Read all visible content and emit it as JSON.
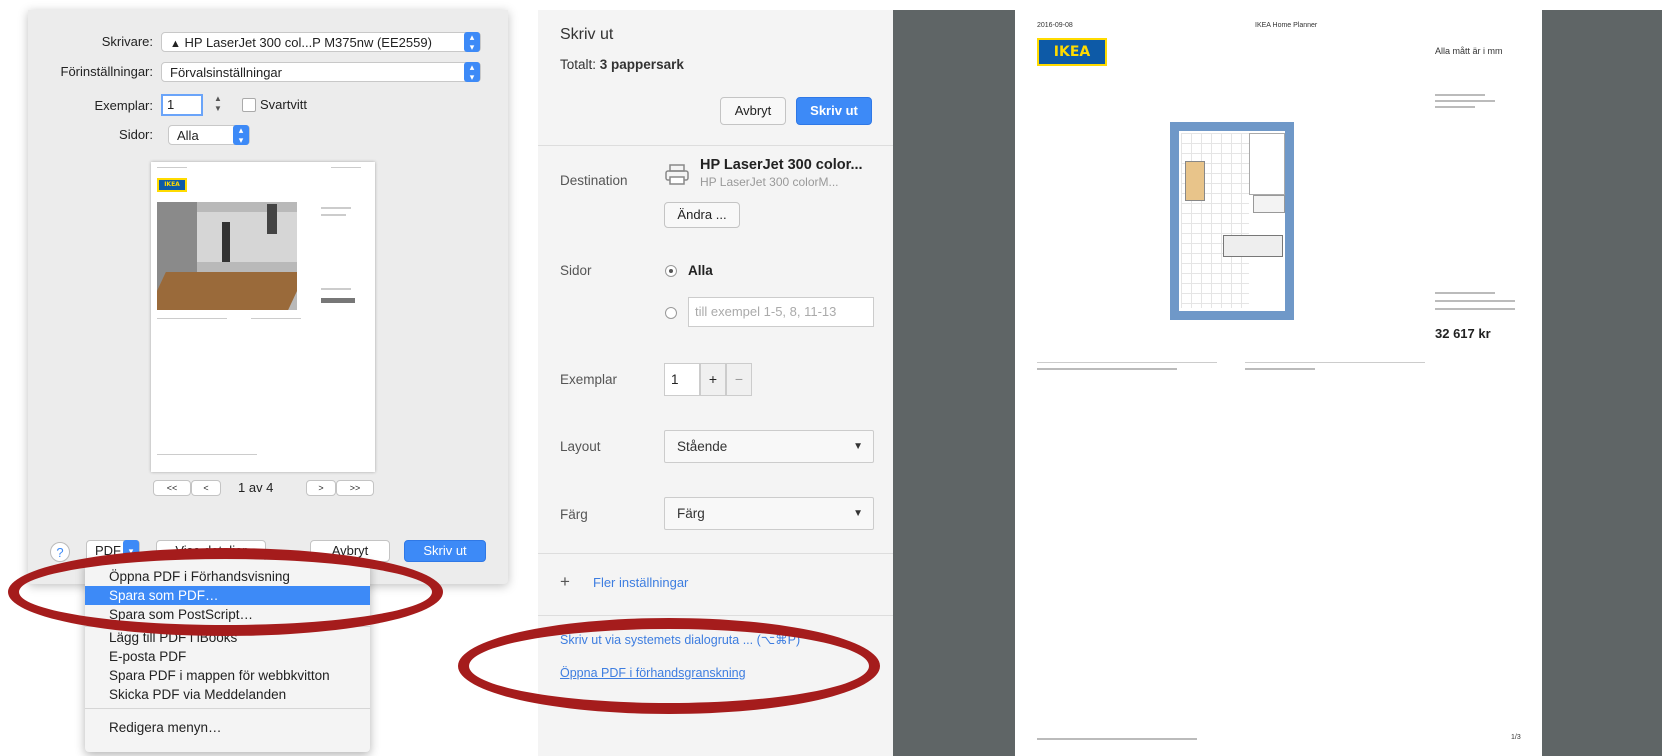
{
  "mac_dialog": {
    "printer_label": "Skrivare:",
    "printer_value": "HP LaserJet 300 col...P M375nw (EE2559)",
    "presets_label": "Förinställningar:",
    "presets_value": "Förvalsinställningar",
    "copies_label": "Exemplar:",
    "copies_value": "1",
    "bw_label": "Svartvitt",
    "pages_label": "Sidor:",
    "pages_value": "Alla",
    "pager_text": "1 av 4",
    "nav_first": "<<",
    "nav_prev": "<",
    "nav_next": ">",
    "nav_last": ">>",
    "help": "?",
    "pdf_button": "PDF",
    "details_button": "Visa detaljer",
    "cancel_button": "Avbryt",
    "print_button": "Skriv ut"
  },
  "pdf_menu": {
    "items": [
      "Öppna PDF i Förhandsvisning",
      "Spara som PDF…",
      "Spara som PostScript…",
      "Lägg till PDF i iBooks",
      "E-posta PDF",
      "Spara PDF i mappen för webbkvitton",
      "Skicka PDF via Meddelanden",
      "Redigera menyn…"
    ],
    "selected_index": 1
  },
  "chrome_dialog": {
    "title": "Skriv ut",
    "total_label": "Totalt:",
    "total_value": "3 pappersark",
    "cancel_button": "Avbryt",
    "print_button": "Skriv ut",
    "destination_label": "Destination",
    "printer_name": "HP LaserJet 300 color...",
    "printer_sub": "HP LaserJet 300 colorM...",
    "change_button": "Ändra ...",
    "pages_label": "Sidor",
    "pages_all": "Alla",
    "pages_placeholder": "till exempel 1-5, 8, 11-13",
    "copies_label": "Exemplar",
    "copies_value": "1",
    "copies_plus": "+",
    "copies_minus": "−",
    "layout_label": "Layout",
    "layout_value": "Stående",
    "color_label": "Färg",
    "color_value": "Färg",
    "more_settings": "Fler inställningar",
    "system_dialog_link": "Skriv ut via systemets dialogruta ... (⌥⌘P)",
    "open_pdf_link": "Öppna PDF i förhandsgranskning"
  },
  "preview_page": {
    "logo": "IKEA",
    "measure_note": "Alla mått är i mm",
    "price": "32 617 kr",
    "header_left": "2016-09-08",
    "header_center": "IKEA Home Planner",
    "footer_right": "1/3"
  },
  "colors": {
    "accent": "#3d8af7",
    "annotation": "#a51c1c",
    "preview_bg": "#5f6566"
  }
}
